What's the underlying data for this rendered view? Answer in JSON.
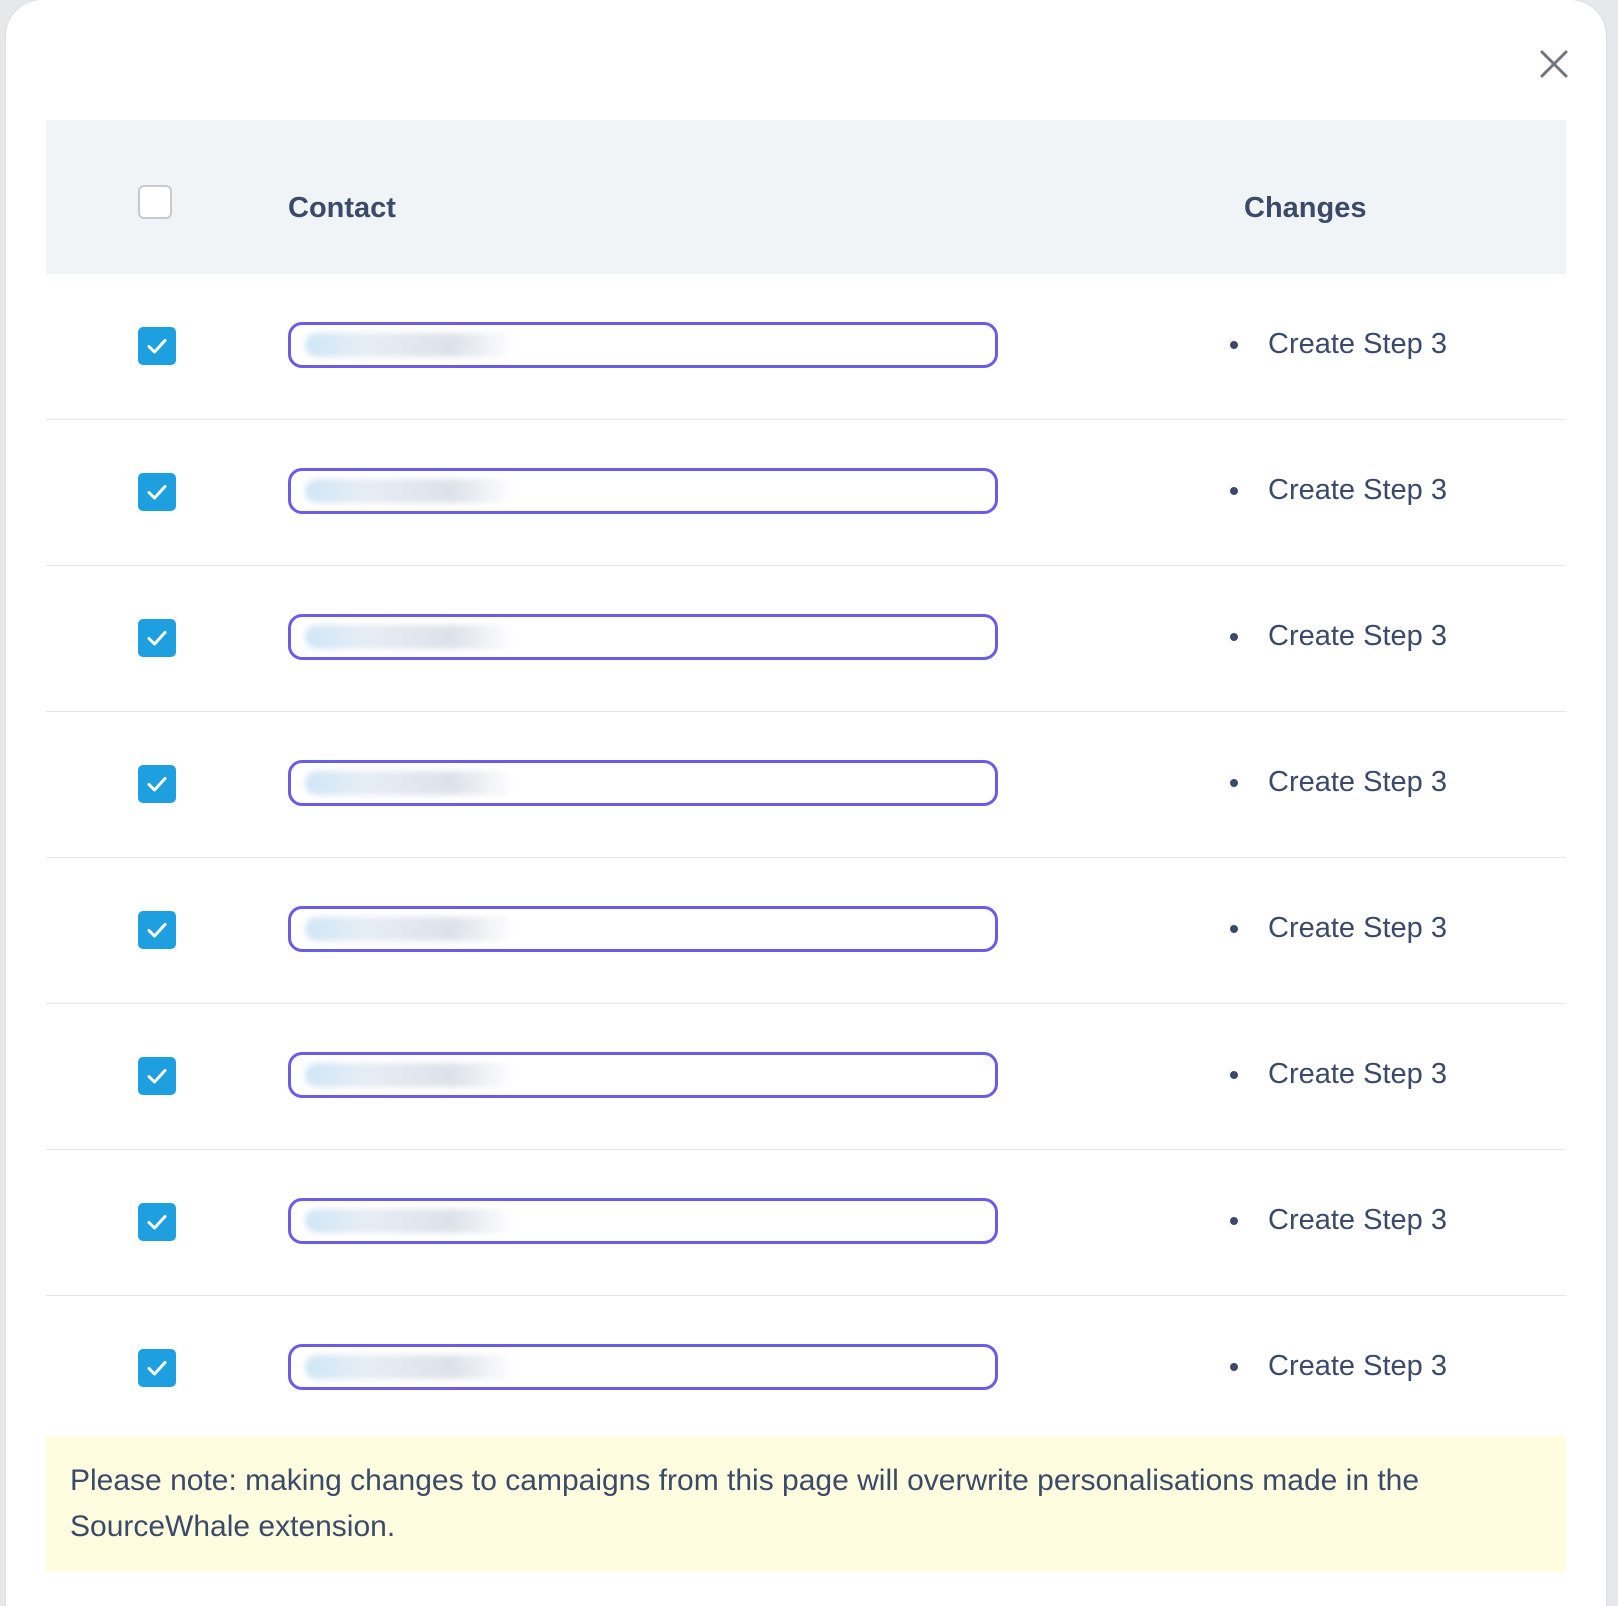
{
  "modal": {
    "close_icon": "close-icon"
  },
  "table": {
    "headers": {
      "contact": "Contact",
      "changes": "Changes"
    },
    "rows": [
      {
        "checked": true,
        "contact": "",
        "change": "Create Step 3"
      },
      {
        "checked": true,
        "contact": "",
        "change": "Create Step 3"
      },
      {
        "checked": true,
        "contact": "",
        "change": "Create Step 3"
      },
      {
        "checked": true,
        "contact": "",
        "change": "Create Step 3"
      },
      {
        "checked": true,
        "contact": "",
        "change": "Create Step 3"
      },
      {
        "checked": true,
        "contact": "",
        "change": "Create Step 3"
      },
      {
        "checked": true,
        "contact": "",
        "change": "Create Step 3"
      },
      {
        "checked": true,
        "contact": "",
        "change": "Create Step 3"
      }
    ]
  },
  "note": {
    "text": "Please note: making changes to campaigns from this page will overwrite personalisations made in the SourceWhale extension."
  },
  "colors": {
    "checkbox_checked": "#1e9fe0",
    "contact_border": "#6b5ce7",
    "header_bg": "#f1f4f7",
    "text": "#3b4a69",
    "note_bg": "#fefde0"
  }
}
